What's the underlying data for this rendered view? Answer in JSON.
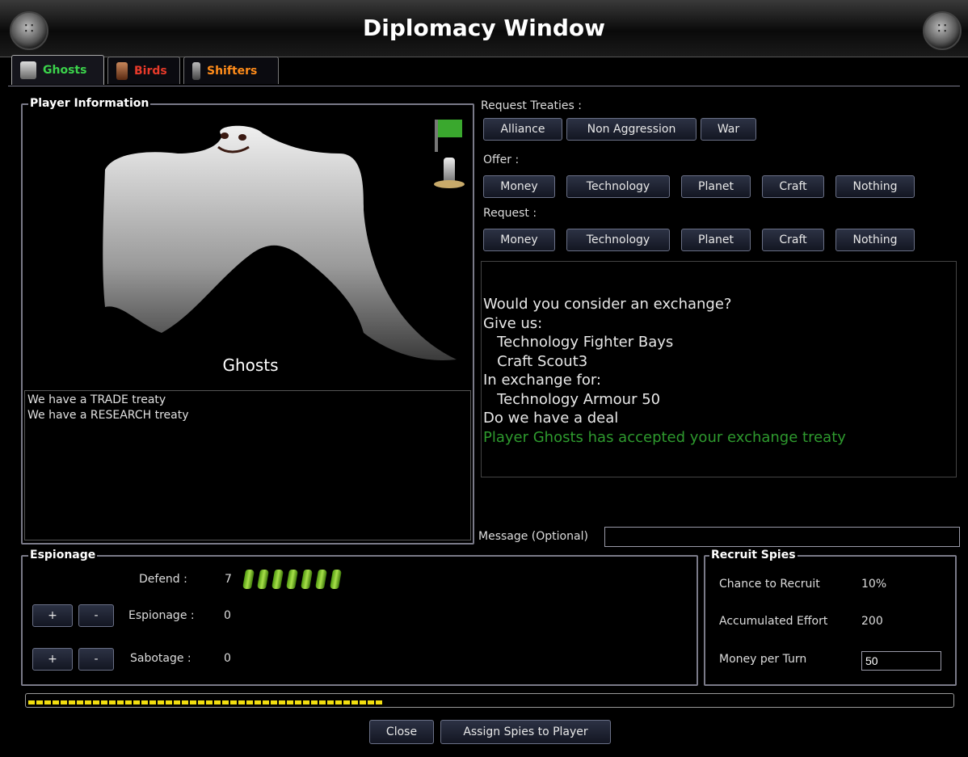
{
  "window": {
    "title": "Diplomacy Window"
  },
  "tabs": [
    {
      "label": "Ghosts",
      "color": "#3bd34b"
    },
    {
      "label": "Birds",
      "color": "#e83a2a"
    },
    {
      "label": "Shifters",
      "color": "#ff8c1a"
    }
  ],
  "player_info": {
    "group_label": "Player Information",
    "player_name": "Ghosts",
    "flag_color": "#3aa82e",
    "treaties": [
      "We have a TRADE treaty",
      "We have a RESEARCH treaty"
    ]
  },
  "request_treaties": {
    "label": "Request Treaties :",
    "buttons": [
      "Alliance",
      "Non Aggression",
      "War"
    ]
  },
  "offer": {
    "label": "Offer :",
    "buttons": [
      "Money",
      "Technology",
      "Planet",
      "Craft",
      "Nothing"
    ]
  },
  "request": {
    "label": "Request :",
    "buttons": [
      "Money",
      "Technology",
      "Planet",
      "Craft",
      "Nothing"
    ]
  },
  "message_log": {
    "lines": [
      "Would you consider an exchange?",
      "Give us:",
      "   Technology Fighter Bays",
      "   Craft Scout3",
      "In exchange for:",
      "   Technology Armour 50",
      "Do we have a deal"
    ],
    "accepted": "Player Ghosts has accepted your exchange treaty",
    "accepted_color": "#2e9a2e"
  },
  "message_field": {
    "label": "Message (Optional)",
    "value": ""
  },
  "espionage": {
    "group_label": "Espionage",
    "defend_label": "Defend :",
    "defend_value": "7",
    "espionage_label": "Espionage :",
    "espionage_value": "0",
    "sabotage_label": "Sabotage :",
    "sabotage_value": "0",
    "plus": "+",
    "minus": "-"
  },
  "recruit": {
    "group_label": "Recruit Spies",
    "chance_label": "Chance to Recruit",
    "chance_value": "10%",
    "effort_label": "Accumulated Effort",
    "effort_value": "200",
    "money_label": "Money per Turn",
    "money_value": "50"
  },
  "progress": {
    "fraction": 0.39,
    "color": "#f2de10"
  },
  "footer": {
    "close": "Close",
    "assign": "Assign Spies to Player"
  }
}
